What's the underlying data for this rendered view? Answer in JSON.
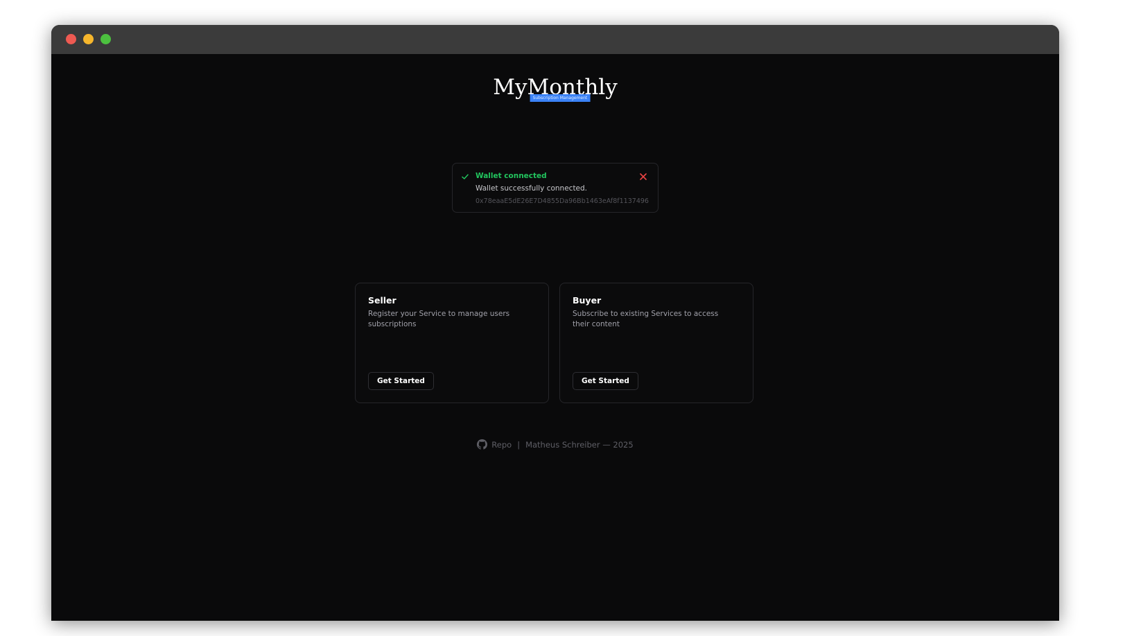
{
  "window": {
    "traffic_lights": {
      "close_color": "#ee5a52",
      "minimize_color": "#f6b62c",
      "maximize_color": "#4cc13f"
    }
  },
  "logo": {
    "title": "MyMonthly",
    "tagline": "Subscription Management",
    "tagline_color": "#3b82f6"
  },
  "toast": {
    "icon": "check-icon",
    "title": "Wallet connected",
    "description": "Wallet successfully connected.",
    "address": "0x78eaaE5dE26E7D4855Da96Bb1463eAf8f1137496",
    "close_icon": "close-icon",
    "success_color": "#22c55e",
    "close_color": "#ef4444"
  },
  "cards": [
    {
      "title": "Seller",
      "description": "Register your Service to manage users subscriptions",
      "button_label": "Get Started"
    },
    {
      "title": "Buyer",
      "description": "Subscribe to existing Services to access their content",
      "button_label": "Get Started"
    }
  ],
  "footer": {
    "icon": "github-icon",
    "repo_label": "Repo",
    "separator": "|",
    "credit": "Matheus Schreiber — 2025"
  }
}
